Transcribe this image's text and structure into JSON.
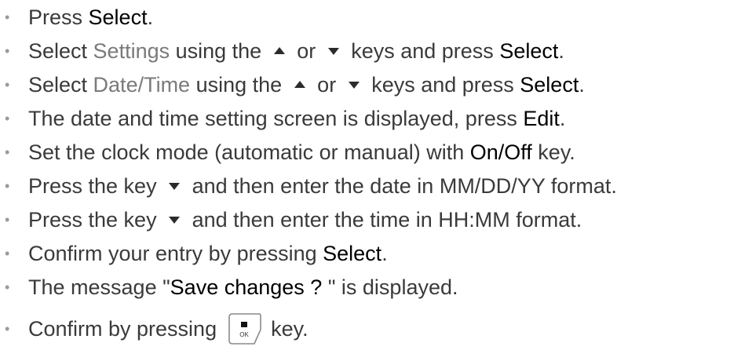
{
  "steps": [
    {
      "parts": [
        {
          "t": "Press ",
          "s": "text"
        },
        {
          "t": "Select",
          "s": "key"
        },
        {
          "t": ".",
          "s": "text"
        }
      ]
    },
    {
      "parts": [
        {
          "t": "Select ",
          "s": "text"
        },
        {
          "t": "Settings",
          "s": "menu"
        },
        {
          "t": " using the ",
          "s": "text"
        },
        {
          "s": "up-arrow-icon"
        },
        {
          "t": " or ",
          "s": "text"
        },
        {
          "s": "down-arrow-icon"
        },
        {
          "t": " keys and press ",
          "s": "text"
        },
        {
          "t": "Select",
          "s": "key"
        },
        {
          "t": ".",
          "s": "text"
        }
      ]
    },
    {
      "parts": [
        {
          "t": "Select ",
          "s": "text"
        },
        {
          "t": "Date/Time",
          "s": "menu"
        },
        {
          "t": " using the ",
          "s": "text"
        },
        {
          "s": "up-arrow-icon"
        },
        {
          "t": " or ",
          "s": "text"
        },
        {
          "s": "down-arrow-icon"
        },
        {
          "t": " keys and press ",
          "s": "text"
        },
        {
          "t": "Select",
          "s": "key"
        },
        {
          "t": ".",
          "s": "text"
        }
      ]
    },
    {
      "parts": [
        {
          "t": "The date and time setting screen is displayed, press ",
          "s": "text"
        },
        {
          "t": "Edit",
          "s": "key"
        },
        {
          "t": ".",
          "s": "text"
        }
      ]
    },
    {
      "parts": [
        {
          "t": "Set the clock mode (automatic or manual) with ",
          "s": "text"
        },
        {
          "t": "On/Off",
          "s": "key"
        },
        {
          "t": " key.",
          "s": "text"
        }
      ]
    },
    {
      "parts": [
        {
          "t": "Press the key ",
          "s": "text"
        },
        {
          "s": "down-arrow-icon"
        },
        {
          "t": " and then enter the date in MM/DD/YY format.",
          "s": "text"
        }
      ]
    },
    {
      "parts": [
        {
          "t": "Press the key ",
          "s": "text"
        },
        {
          "s": "down-arrow-icon"
        },
        {
          "t": " and then enter the time in HH:MM format.",
          "s": "text"
        }
      ]
    },
    {
      "parts": [
        {
          "t": "Confirm your entry by pressing ",
          "s": "text"
        },
        {
          "t": "Select",
          "s": "key"
        },
        {
          "t": ".",
          "s": "text"
        }
      ]
    },
    {
      "parts": [
        {
          "t": "The message \"",
          "s": "text"
        },
        {
          "t": "Save changes ? ",
          "s": "key"
        },
        {
          "t": "\" is displayed.",
          "s": "text"
        }
      ]
    },
    {
      "parts": [
        {
          "t": "Confirm by pressing ",
          "s": "text"
        },
        {
          "s": "ok-key-icon",
          "label": "OK"
        },
        {
          "t": " key.",
          "s": "text"
        }
      ]
    }
  ],
  "bullet": "•",
  "colors": {
    "text": "#3a3a3a",
    "key": "#000000",
    "menu": "#7a7a7a",
    "bullet": "#9a9a9a"
  }
}
